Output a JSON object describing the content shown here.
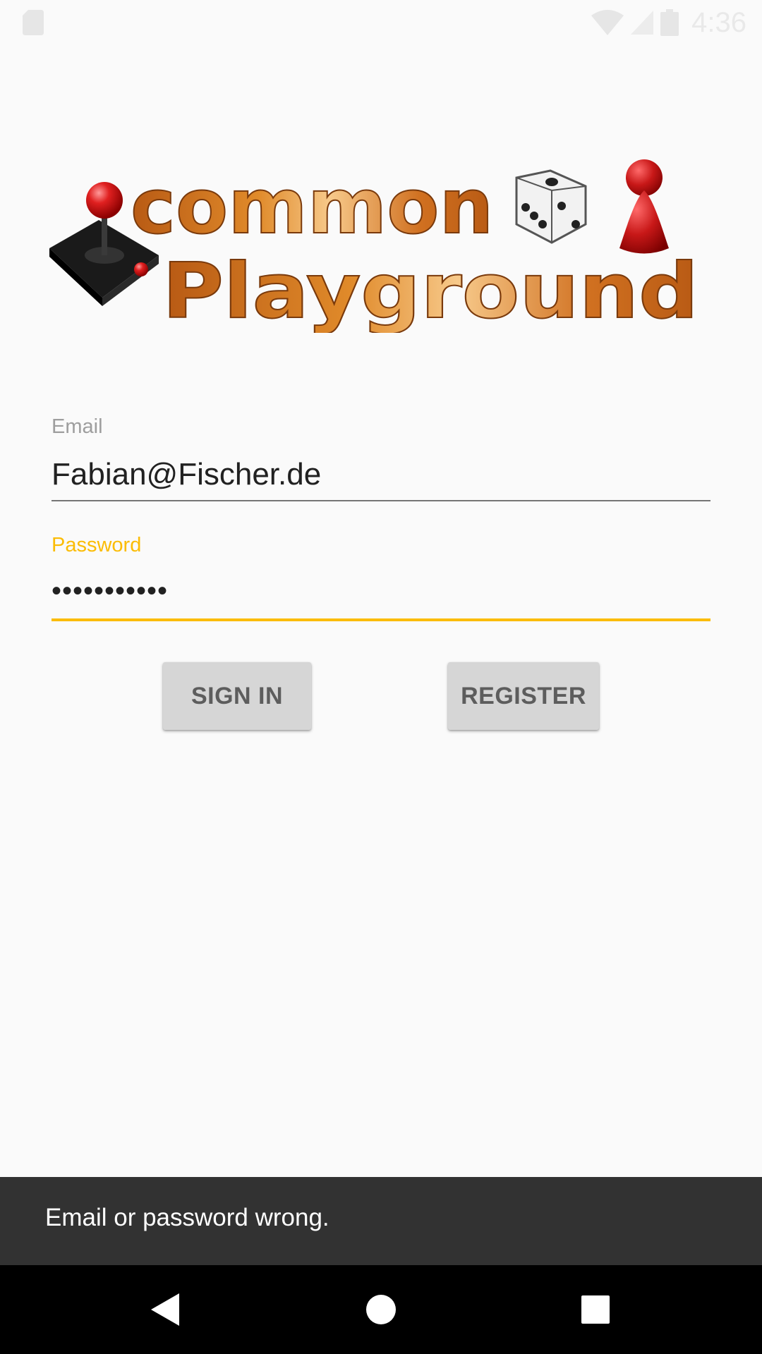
{
  "status_bar": {
    "time": "4:36",
    "icons": [
      "sd-card-icon",
      "wifi-icon",
      "cell-signal-icon",
      "battery-icon"
    ]
  },
  "logo": {
    "line1": "common",
    "line2": "Playground",
    "colors": {
      "text": "#c8691a",
      "highlight": "#f4c27a",
      "outline": "#7a3a0c"
    }
  },
  "form": {
    "email": {
      "label": "Email",
      "value": "Fabian@Fischer.de"
    },
    "password": {
      "label": "Password",
      "value": "•••••••••••"
    }
  },
  "buttons": {
    "sign_in": "SIGN IN",
    "register": "REGISTER"
  },
  "snackbar": {
    "message": "Email or password wrong."
  },
  "colors": {
    "accent": "#fbbc05",
    "background": "#fafafa",
    "snackbar": "#323232",
    "button": "#d6d6d6"
  }
}
